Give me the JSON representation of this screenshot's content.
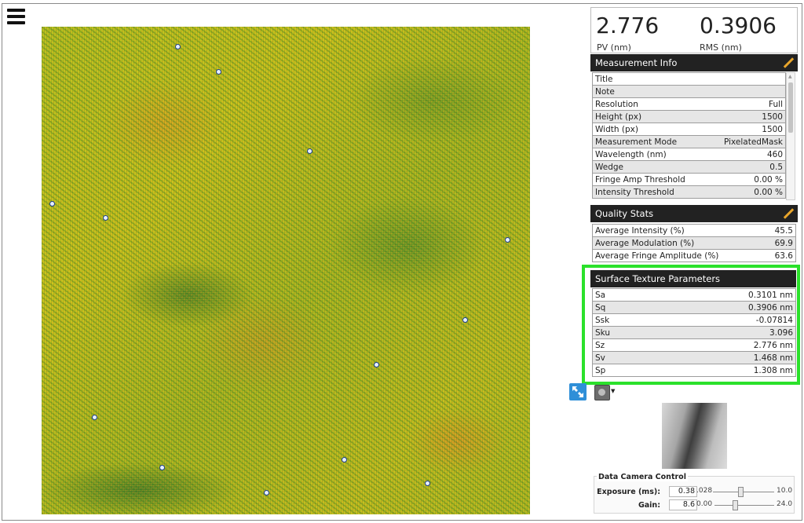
{
  "summary": {
    "pv_value": "2.776",
    "pv_label": "PV (nm)",
    "rms_value": "0.3906",
    "rms_label": "RMS (nm)"
  },
  "measurement_info": {
    "title": "Measurement Info",
    "rows": [
      {
        "label": "Title",
        "value": ""
      },
      {
        "label": "Note",
        "value": ""
      },
      {
        "label": "Resolution",
        "value": "Full"
      },
      {
        "label": "Height (px)",
        "value": "1500"
      },
      {
        "label": "Width (px)",
        "value": "1500"
      },
      {
        "label": "Measurement Mode",
        "value": "PixelatedMask"
      },
      {
        "label": "Wavelength (nm)",
        "value": "460"
      },
      {
        "label": "Wedge",
        "value": "0.5"
      },
      {
        "label": "Fringe Amp Threshold",
        "value": "0.00 %"
      },
      {
        "label": "Intensity Threshold",
        "value": "0.00 %"
      }
    ]
  },
  "quality_stats": {
    "title": "Quality Stats",
    "rows": [
      {
        "label": "Average Intensity (%)",
        "value": "45.5"
      },
      {
        "label": "Average Modulation (%)",
        "value": "69.9"
      },
      {
        "label": "Average Fringe Amplitude (%)",
        "value": "63.6"
      }
    ]
  },
  "surface_texture": {
    "title": "Surface Texture Parameters",
    "rows": [
      {
        "label": "Sa",
        "value": "0.3101 nm"
      },
      {
        "label": "Sq",
        "value": "0.3906 nm"
      },
      {
        "label": "Ssk",
        "value": "-0.07814"
      },
      {
        "label": "Sku",
        "value": "3.096"
      },
      {
        "label": "Sz",
        "value": "2.776 nm"
      },
      {
        "label": "Sv",
        "value": "1.468 nm"
      },
      {
        "label": "Sp",
        "value": "1.308 nm"
      }
    ]
  },
  "camera_control": {
    "title": "Data Camera Control",
    "exposure_label": "Exposure (ms):",
    "exposure_value": "0.38",
    "exposure_min": ".028",
    "exposure_max": "10.0",
    "gain_label": "Gain:",
    "gain_value": "8.6",
    "gain_min": "0.00",
    "gain_max": "24.0"
  },
  "colors": {
    "highlight": "#2be12b",
    "header_bg": "#222222",
    "accent": "#2f8fd8"
  },
  "icons": {
    "menu": "hamburger-menu-icon",
    "edit": "pencil-icon",
    "expand": "expand-arrows-icon",
    "view": "view-mode-icon"
  }
}
